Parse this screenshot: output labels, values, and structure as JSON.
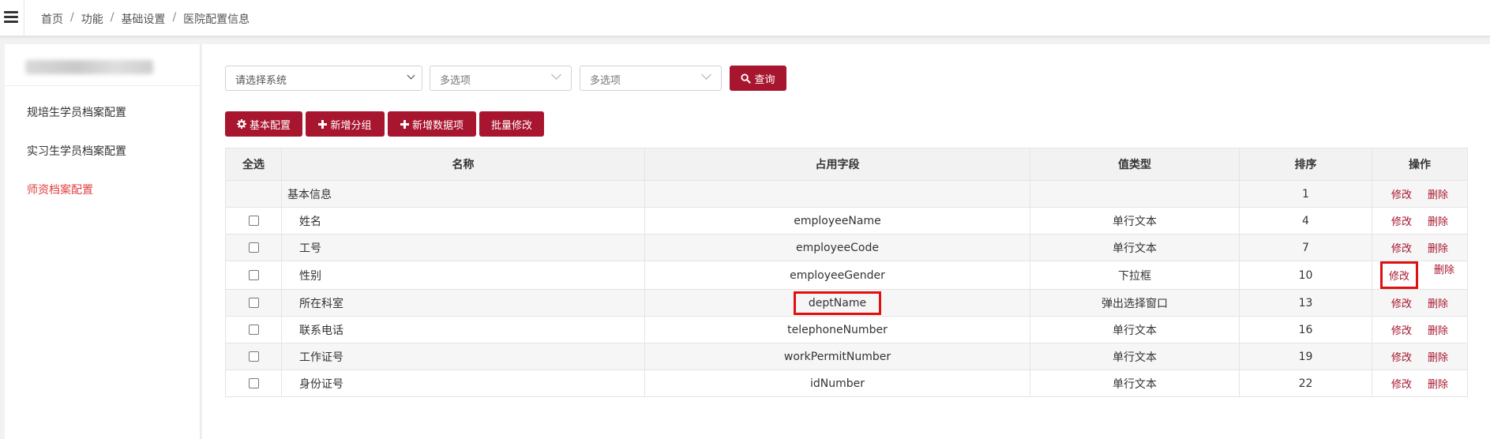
{
  "breadcrumb": [
    "首页",
    "功能",
    "基础设置",
    "医院配置信息"
  ],
  "sidebar": {
    "items": [
      {
        "label": "规培生学员档案配置",
        "active": false
      },
      {
        "label": "实习生学员档案配置",
        "active": false
      },
      {
        "label": "师资档案配置",
        "active": true
      }
    ]
  },
  "filters": {
    "system_select": "请选择系统",
    "multi_select_1": "多选项",
    "multi_select_2": "多选项",
    "query_label": "查询"
  },
  "toolbar": {
    "basic_config": "基本配置",
    "add_group": "新增分组",
    "add_data_item": "新增数据项",
    "batch_edit": "批量修改"
  },
  "table": {
    "headers": [
      "全选",
      "名称",
      "占用字段",
      "值类型",
      "排序",
      "操作"
    ],
    "rows": [
      {
        "name": "基本信息",
        "field": "",
        "type": "",
        "order": "1",
        "edit": "修改",
        "delete": "删除"
      },
      {
        "name": "姓名",
        "field": "employeeName",
        "type": "单行文本",
        "order": "4",
        "edit": "修改",
        "delete": "删除"
      },
      {
        "name": "工号",
        "field": "employeeCode",
        "type": "单行文本",
        "order": "7",
        "edit": "修改",
        "delete": "删除"
      },
      {
        "name": "性别",
        "field": "employeeGender",
        "type": "下拉框",
        "order": "10",
        "edit": "修改",
        "delete": "删除"
      },
      {
        "name": "所在科室",
        "field": "deptName",
        "type": "弹出选择窗口",
        "order": "13",
        "edit": "修改",
        "delete": "删除"
      },
      {
        "name": "联系电话",
        "field": "telephoneNumber",
        "type": "单行文本",
        "order": "16",
        "edit": "修改",
        "delete": "删除"
      },
      {
        "name": "工作证号",
        "field": "workPermitNumber",
        "type": "单行文本",
        "order": "19",
        "edit": "修改",
        "delete": "删除"
      },
      {
        "name": "身份证号",
        "field": "idNumber",
        "type": "单行文本",
        "order": "22",
        "edit": "修改",
        "delete": "删除"
      }
    ]
  },
  "colors": {
    "accent": "#a8152e",
    "active_sidebar": "#e03e3e",
    "highlight_box": "#e01010"
  }
}
